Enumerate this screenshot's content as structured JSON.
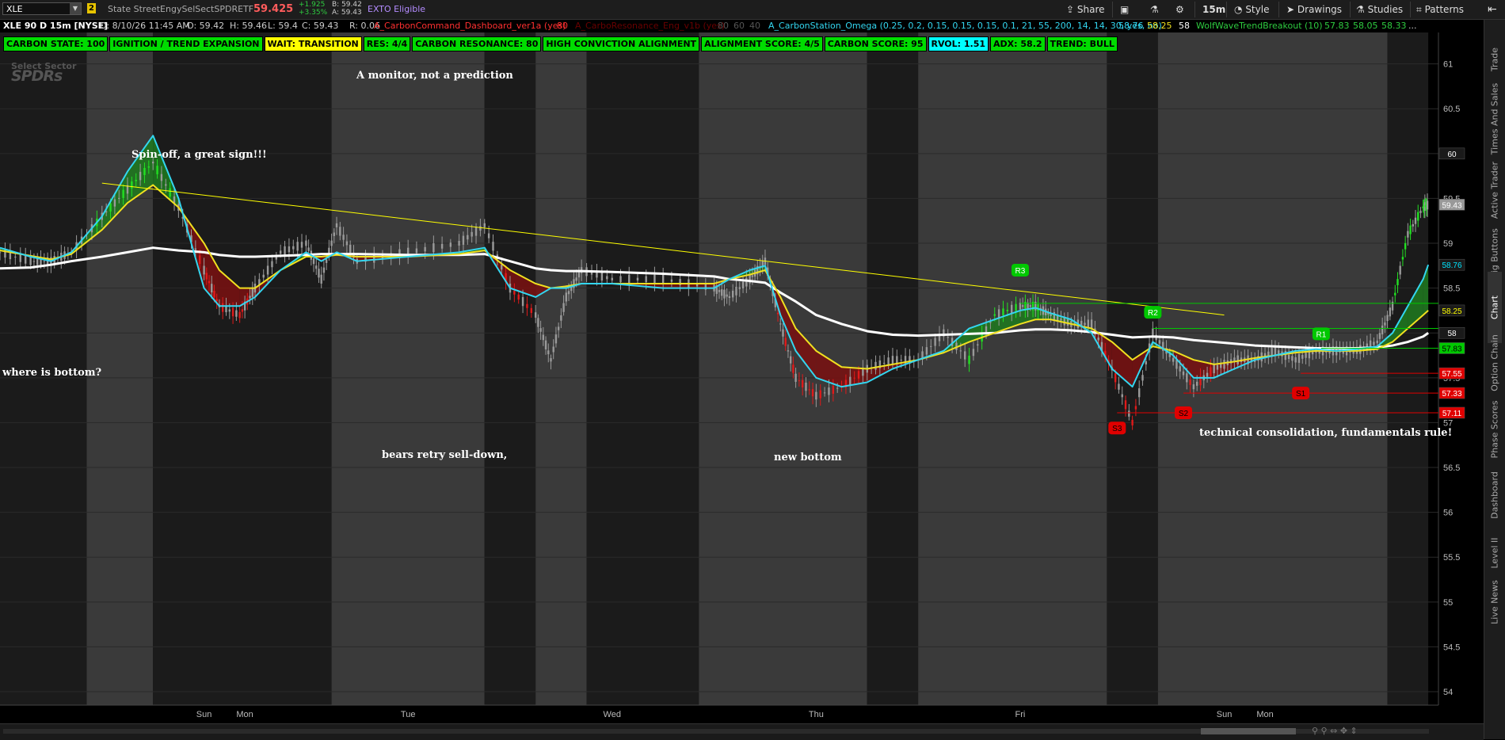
{
  "toolbar": {
    "symbol": "XLE",
    "link_number": "2",
    "description": "State StreetEngySelSectSPDRETF",
    "last_price": "59.425",
    "change_abs": "+1.925",
    "change_pct": "+3.35%",
    "bid": "B: 59.42",
    "ask": "A: 59.43",
    "exto": "EXTO Eligible",
    "buttons": {
      "share": "Share",
      "timeframe": "15m",
      "style": "Style",
      "drawings": "Drawings",
      "studies": "Studies",
      "patterns": "Patterns"
    }
  },
  "right_tabs": [
    "Trade",
    "Times And Sales",
    "Active Trader",
    "Big Buttons",
    "Chart",
    "Option Chain",
    "Phase Scores",
    "Dashboard",
    "Level II",
    "Live News"
  ],
  "info_bar": {
    "title": "XLE 90 D 15m [NYSE]",
    "date": "D: 8/10/26 11:45 AM",
    "open": "O: 59.42",
    "high": "H: 59.46",
    "low": "L: 59.4",
    "close": "C: 59.43",
    "range": "R: 0.06",
    "study1": "A_CarbonCommand_Dashboard_ver1a (yes)",
    "study1_val": "80",
    "study2": "A_CarboResonance_Eng_v1b (yes)",
    "study2_v1": "80",
    "study2_v2": "60",
    "study2_v3": "40",
    "study3": "A_CarbonStation_Omega (0.25, 0.2, 0.15, 0.15, 0.15, 0.1, 21, 55, 200, 14, 14, 30, yes, no)",
    "study3_v1": "58.76",
    "study3_v2": "58.25",
    "study3_v3": "58",
    "study4": "WolfWaveTrendBreakout (10)",
    "study4_v1": "57.83",
    "study4_v2": "58.05",
    "study4_v3": "58.33",
    "more": "..."
  },
  "labels": [
    {
      "text": "CARBON STATE: 100",
      "color": "#00dc00"
    },
    {
      "text": "IGNITION / TREND EXPANSION",
      "color": "#00dc00"
    },
    {
      "text": "WAIT: TRANSITION",
      "color": "#ffff00"
    },
    {
      "text": "RES: 4/4",
      "color": "#00dc00"
    },
    {
      "text": "CARBON RESONANCE: 80",
      "color": "#00dc00"
    },
    {
      "text": "HIGH CONVICTION ALIGNMENT",
      "color": "#00dc00"
    },
    {
      "text": "ALIGNMENT SCORE: 4/5",
      "color": "#00dc00"
    },
    {
      "text": "CARBON SCORE: 95",
      "color": "#00dc00"
    },
    {
      "text": "RVOL: 1.51",
      "color": "#00ffff"
    },
    {
      "text": "ADX: 58.2",
      "color": "#00dc00"
    },
    {
      "text": "TREND: BULL",
      "color": "#00dc00"
    }
  ],
  "watermark": {
    "line1": "Select Sector",
    "line2": "SPDRs"
  },
  "annotations": [
    {
      "text": "A monitor, not a prediction"
    },
    {
      "text": "Spin-off, a great sign!!!"
    },
    {
      "text": "where is bottom?"
    },
    {
      "text": "bears retry sell-down,"
    },
    {
      "text": "new bottom"
    },
    {
      "text": "technical consolidation, fundamentals rule!"
    }
  ],
  "chart_data": {
    "type": "candlestick",
    "symbol": "XLE",
    "timeframe": "15m",
    "y_ticks": [
      61,
      60.5,
      60,
      59.5,
      59,
      58.5,
      58,
      57.5,
      57,
      56.5,
      56,
      55.5,
      55,
      54.5,
      54
    ],
    "ylim": [
      53.85,
      61.35
    ],
    "x_labels": [
      {
        "text": "Sun",
        "t": 14.0
      },
      {
        "text": "Mon",
        "t": 14.8
      },
      {
        "text": "Tue",
        "t": 18.0
      },
      {
        "text": "Wed",
        "t": 22.0
      },
      {
        "text": "Thu",
        "t": 26.0
      },
      {
        "text": "Fri",
        "t": 30.0
      },
      {
        "text": "Sun",
        "t": 34.0
      },
      {
        "text": "Mon",
        "t": 34.8
      }
    ],
    "price_badges": [
      {
        "value": "60",
        "y": 60.0,
        "color": "#1a1a1a",
        "text_color": "#ffffff"
      },
      {
        "value": "59.43",
        "y": 59.43,
        "color": "#999999",
        "text_color": "#ffffff"
      },
      {
        "value": "58.76",
        "y": 58.76,
        "color": "#1a1a1a",
        "text_color": "#00e5ff"
      },
      {
        "value": "58.25",
        "y": 58.25,
        "color": "#1a1a1a",
        "text_color": "#ffff00"
      },
      {
        "value": "58",
        "y": 58.0,
        "color": "#1a1a1a",
        "text_color": "#ffffff"
      },
      {
        "value": "57.83",
        "y": 57.83,
        "color": "#00c800",
        "text_color": "#000000"
      },
      {
        "value": "57.55",
        "y": 57.55,
        "color": "#e00000",
        "text_color": "#ffffff"
      },
      {
        "value": "57.33",
        "y": 57.33,
        "color": "#e00000",
        "text_color": "#ffffff"
      },
      {
        "value": "57.11",
        "y": 57.11,
        "color": "#e00000",
        "text_color": "#ffffff"
      }
    ],
    "pivots": [
      {
        "label": "R3",
        "t": 30.0,
        "y": 58.7,
        "color": "#00c800"
      },
      {
        "label": "R2",
        "t": 32.6,
        "y": 58.23,
        "color": "#00c800"
      },
      {
        "label": "R1",
        "t": 35.9,
        "y": 57.99,
        "color": "#00c800"
      },
      {
        "label": "S1",
        "t": 35.5,
        "y": 57.33,
        "color": "#e00000"
      },
      {
        "label": "S2",
        "t": 33.2,
        "y": 57.11,
        "color": "#e00000"
      },
      {
        "label": "S3",
        "t": 31.9,
        "y": 56.94,
        "color": "#e00000"
      }
    ],
    "levels": [
      {
        "y": 58.33,
        "t0": 30.0,
        "t1": 38.0,
        "color": "#00c800"
      },
      {
        "y": 58.05,
        "t0": 32.6,
        "t1": 38.0,
        "color": "#00c800"
      },
      {
        "y": 57.83,
        "t0": 35.9,
        "t1": 38.0,
        "color": "#00c800"
      },
      {
        "y": 57.55,
        "t0": 35.5,
        "t1": 38.0,
        "color": "#e00000"
      },
      {
        "y": 57.33,
        "t0": 33.2,
        "t1": 38.0,
        "color": "#e00000"
      },
      {
        "y": 57.11,
        "t0": 31.9,
        "t1": 38.0,
        "color": "#e00000"
      }
    ],
    "trendline": {
      "t": [
        12.0,
        34.0
      ],
      "y": [
        59.67,
        58.2
      ],
      "color": "#ffff00"
    },
    "series": {
      "t": [
        10.0,
        10.6,
        11.0,
        11.4,
        12.0,
        12.5,
        13.0,
        13.5,
        14.0,
        14.3,
        14.7,
        15.0,
        15.5,
        16.0,
        16.3,
        16.6,
        17.0,
        18.0,
        19.0,
        19.5,
        20.0,
        20.5,
        20.8,
        21.1,
        21.4,
        22.0,
        23.0,
        24.0,
        24.3,
        24.7,
        25.0,
        25.3,
        25.6,
        26.0,
        26.5,
        27.0,
        27.5,
        28.0,
        28.5,
        29.0,
        29.5,
        30.0,
        30.3,
        30.6,
        31.0,
        31.4,
        31.8,
        32.2,
        32.6,
        33.0,
        33.4,
        33.8,
        34.2,
        34.6,
        35.0,
        35.4,
        35.8,
        36.2,
        36.6,
        37.0,
        37.3,
        37.6,
        37.9,
        38.0
      ],
      "close": [
        58.9,
        58.8,
        58.8,
        58.9,
        59.3,
        59.6,
        59.9,
        59.4,
        58.7,
        58.3,
        58.2,
        58.5,
        58.9,
        59.0,
        58.6,
        59.2,
        58.8,
        58.9,
        59.0,
        59.2,
        58.5,
        58.2,
        57.7,
        58.4,
        58.7,
        58.6,
        58.6,
        58.5,
        58.4,
        58.6,
        58.8,
        58.1,
        57.5,
        57.3,
        57.4,
        57.6,
        57.7,
        57.7,
        58.0,
        57.7,
        58.2,
        58.3,
        58.3,
        58.2,
        58.1,
        58.1,
        57.6,
        57.0,
        58.0,
        57.7,
        57.4,
        57.6,
        57.7,
        57.7,
        57.8,
        57.7,
        57.8,
        57.8,
        57.8,
        57.9,
        58.3,
        59.1,
        59.4,
        59.43
      ],
      "ema_fast": [
        58.95,
        58.85,
        58.8,
        58.9,
        59.3,
        59.8,
        60.2,
        59.5,
        58.5,
        58.3,
        58.3,
        58.4,
        58.7,
        58.9,
        58.8,
        58.9,
        58.8,
        58.85,
        58.9,
        58.95,
        58.5,
        58.4,
        58.5,
        58.5,
        58.55,
        58.55,
        58.5,
        58.5,
        58.6,
        58.7,
        58.75,
        58.2,
        57.8,
        57.5,
        57.4,
        57.45,
        57.6,
        57.7,
        57.8,
        58.05,
        58.15,
        58.25,
        58.28,
        58.22,
        58.15,
        58.0,
        57.6,
        57.4,
        57.9,
        57.75,
        57.5,
        57.5,
        57.6,
        57.7,
        57.75,
        57.8,
        57.82,
        57.8,
        57.82,
        57.85,
        58.0,
        58.3,
        58.6,
        58.76
      ],
      "ema_mid": [
        58.92,
        58.86,
        58.82,
        58.88,
        59.15,
        59.45,
        59.65,
        59.4,
        59.0,
        58.7,
        58.5,
        58.5,
        58.7,
        58.85,
        58.85,
        58.87,
        58.85,
        58.85,
        58.88,
        58.92,
        58.7,
        58.55,
        58.5,
        58.52,
        58.55,
        58.55,
        58.55,
        58.55,
        58.6,
        58.65,
        58.7,
        58.4,
        58.05,
        57.8,
        57.62,
        57.6,
        57.65,
        57.7,
        57.78,
        57.9,
        58.0,
        58.1,
        58.15,
        58.15,
        58.1,
        58.05,
        57.9,
        57.7,
        57.85,
        57.8,
        57.7,
        57.65,
        57.68,
        57.72,
        57.75,
        57.78,
        57.8,
        57.8,
        57.8,
        57.82,
        57.9,
        58.05,
        58.2,
        58.25
      ],
      "sma_slow": [
        58.72,
        58.73,
        58.76,
        58.8,
        58.85,
        58.9,
        58.95,
        58.92,
        58.9,
        58.87,
        58.85,
        58.85,
        58.86,
        58.87,
        58.88,
        58.88,
        58.88,
        58.87,
        58.87,
        58.88,
        58.8,
        58.72,
        58.7,
        58.69,
        58.69,
        58.68,
        58.66,
        58.63,
        58.6,
        58.58,
        58.56,
        58.45,
        58.35,
        58.2,
        58.1,
        58.02,
        57.98,
        57.97,
        57.98,
        57.99,
        58.0,
        58.03,
        58.04,
        58.04,
        58.03,
        58.01,
        57.98,
        57.95,
        57.96,
        57.95,
        57.92,
        57.9,
        57.88,
        57.86,
        57.85,
        57.84,
        57.83,
        57.83,
        57.83,
        57.84,
        57.86,
        57.9,
        57.96,
        58.0
      ]
    },
    "session_bands": [
      {
        "t0": 10.0,
        "t1": 11.7,
        "shade": "night"
      },
      {
        "t0": 11.7,
        "t1": 13.0,
        "shade": "day"
      },
      {
        "t0": 13.0,
        "t1": 16.5,
        "shade": "night"
      },
      {
        "t0": 16.5,
        "t1": 19.5,
        "shade": "day"
      },
      {
        "t0": 19.5,
        "t1": 20.5,
        "shade": "night"
      },
      {
        "t0": 20.5,
        "t1": 21.5,
        "shade": "day"
      },
      {
        "t0": 21.5,
        "t1": 23.7,
        "shade": "night"
      },
      {
        "t0": 23.7,
        "t1": 27.0,
        "shade": "day"
      },
      {
        "t0": 27.0,
        "t1": 28.0,
        "shade": "night"
      },
      {
        "t0": 28.0,
        "t1": 31.7,
        "shade": "day"
      },
      {
        "t0": 31.7,
        "t1": 32.7,
        "shade": "night"
      },
      {
        "t0": 32.7,
        "t1": 37.2,
        "shade": "day"
      },
      {
        "t0": 37.2,
        "t1": 38.0,
        "shade": "night"
      }
    ],
    "t_range": [
      10.0,
      38.2
    ],
    "colors": {
      "ema_fast": "#33d6f0",
      "ema_mid": "#f0e020",
      "sma_slow": "#ffffff",
      "bull_fill": "#1f7a1f",
      "bear_fill": "#7a1010",
      "day_band": "#3a3a3a",
      "night_band": "#1b1b1b",
      "grid": "#2a2a2a"
    }
  }
}
